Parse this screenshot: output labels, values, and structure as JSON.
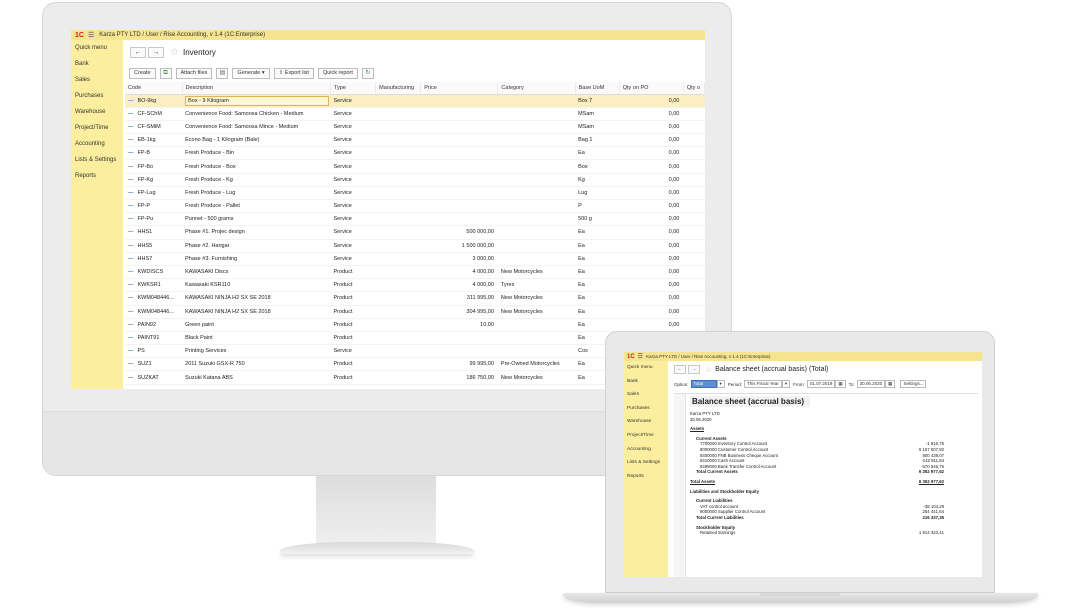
{
  "desktop": {
    "titlebar": "Karza PTY LTD / User / Rise Accounting, v 1.4   (1C:Enterprise)",
    "logo": "1C",
    "sidebar": [
      "Quick menu",
      "Bank",
      "Sales",
      "Purchases",
      "Warehouse",
      "Project/Time",
      "Accounting",
      "Lists & Settings",
      "Reports"
    ],
    "page_title": "Inventory",
    "toolbar": {
      "create": "Create",
      "attach": "Attach files",
      "generate": "Generate",
      "export": "Export list",
      "quick_report": "Quick report"
    },
    "columns": [
      "Code",
      "Description",
      "Type",
      "Manufacturing",
      "Price",
      "Category",
      "Base UoM",
      "Qty on PO",
      "Qty o"
    ],
    "rows": [
      {
        "code": "BO-9kg",
        "desc": "Box - 9 Kilogram",
        "type": "Service",
        "mfg": "",
        "price": "",
        "cat": "",
        "uom": "Box 7",
        "qty": "0,00"
      },
      {
        "code": "CF-SChM",
        "desc": "Convenience Food: Samoosa Chicken - Medium",
        "type": "Service",
        "mfg": "",
        "price": "",
        "cat": "",
        "uom": "MSam",
        "qty": "0,00"
      },
      {
        "code": "CF-SMiM",
        "desc": "Convenience Food: Samoosa Mince - Medium",
        "type": "Service",
        "mfg": "",
        "price": "",
        "cat": "",
        "uom": "MSam",
        "qty": "0,00"
      },
      {
        "code": "EB-1kg",
        "desc": "Econo Bag - 1 Kilogram (Bale)",
        "type": "Service",
        "mfg": "",
        "price": "",
        "cat": "",
        "uom": "Bag 1",
        "qty": "0,00"
      },
      {
        "code": "FP-B",
        "desc": "Fresh Produce - Bin",
        "type": "Service",
        "mfg": "",
        "price": "",
        "cat": "",
        "uom": "Ea",
        "qty": "0,00"
      },
      {
        "code": "FP-Bo",
        "desc": "Fresh Produce - Box",
        "type": "Service",
        "mfg": "",
        "price": "",
        "cat": "",
        "uom": "Box",
        "qty": "0,00"
      },
      {
        "code": "FP-Kg",
        "desc": "Fresh Produce - Kg",
        "type": "Service",
        "mfg": "",
        "price": "",
        "cat": "",
        "uom": "Kg",
        "qty": "0,00"
      },
      {
        "code": "FP-Lug",
        "desc": "Fresh Produce - Lug",
        "type": "Service",
        "mfg": "",
        "price": "",
        "cat": "",
        "uom": "Lug",
        "qty": "0,00"
      },
      {
        "code": "FP-P",
        "desc": "Fresh Produce - Pallet",
        "type": "Service",
        "mfg": "",
        "price": "",
        "cat": "",
        "uom": "P",
        "qty": "0,00"
      },
      {
        "code": "FP-Pu",
        "desc": "Punnet - 500 grams",
        "type": "Service",
        "mfg": "",
        "price": "",
        "cat": "",
        "uom": "500 g",
        "qty": "0,00"
      },
      {
        "code": "HHS1",
        "desc": "Phase #1. Projec design",
        "type": "Service",
        "mfg": "",
        "price": "500 000,00",
        "cat": "",
        "uom": "Ea",
        "qty": "0,00"
      },
      {
        "code": "HHS5",
        "desc": "Phase #2. Hangar",
        "type": "Service",
        "mfg": "",
        "price": "1 500 000,00",
        "cat": "",
        "uom": "Ea",
        "qty": "0,00"
      },
      {
        "code": "HHS7",
        "desc": "Phase #3. Furnishing",
        "type": "Service",
        "mfg": "",
        "price": "3 000,00",
        "cat": "",
        "uom": "Ea",
        "qty": "0,00"
      },
      {
        "code": "KWDISCS",
        "desc": "KAWASAKI Discs",
        "type": "Product",
        "mfg": "",
        "price": "4 000,00",
        "cat": "New Motorcycles",
        "uom": "Ea",
        "qty": "0,00"
      },
      {
        "code": "KWKSR1",
        "desc": "Kawasaki KSR110",
        "type": "Product",
        "mfg": "",
        "price": "4 000,00",
        "cat": "Tyres",
        "uom": "Ea",
        "qty": "0,00"
      },
      {
        "code": "KWM048446...",
        "desc": "KAWASAKI NINJA H2 SX SE 2018",
        "type": "Product",
        "mfg": "",
        "price": "311 995,00",
        "cat": "New Motorcycles",
        "uom": "Ea",
        "qty": "0,00"
      },
      {
        "code": "KWM048446...",
        "desc": "KAWASAKI NINJA H2 SX SE 2018",
        "type": "Product",
        "mfg": "",
        "price": "304 995,00",
        "cat": "New Motorcycles",
        "uom": "Ea",
        "qty": "0,00"
      },
      {
        "code": "PAIN92",
        "desc": "Green paint",
        "type": "Product",
        "mfg": "",
        "price": "10,00",
        "cat": "",
        "uom": "Ea",
        "qty": "0,00"
      },
      {
        "code": "PAINT91",
        "desc": "Black Paint",
        "type": "Product",
        "mfg": "",
        "price": "",
        "cat": "",
        "uom": "Ea",
        "qty": ""
      },
      {
        "code": "PS",
        "desc": "Printing Services",
        "type": "Service",
        "mfg": "",
        "price": "",
        "cat": "",
        "uom": "Cos",
        "qty": ""
      },
      {
        "code": "SUZ1",
        "desc": "2011 Suzuki GSX-R 750",
        "type": "Product",
        "mfg": "",
        "price": "99 995,00",
        "cat": "Pre-Owned Motorcycles",
        "uom": "Ea",
        "qty": ""
      },
      {
        "code": "SUZKAT",
        "desc": "Suzuki Katana ABS",
        "type": "Product",
        "mfg": "",
        "price": "186 750,00",
        "cat": "New Motorcycles",
        "uom": "Ea",
        "qty": ""
      }
    ]
  },
  "laptop": {
    "titlebar": "Karza PTY LTD / User / Rise Accounting, v 1.4   (1C:Enterprise)",
    "logo": "1C",
    "sidebar": [
      "Quick menu",
      "Bank",
      "Sales",
      "Purchases",
      "Warehouse",
      "Project/Time",
      "Accounting",
      "Lists & Settings",
      "Reports"
    ],
    "page_title": "Balance sheet (accrual basis) (Total)",
    "options": {
      "option_label": "Option:",
      "option_value": "Total",
      "period_label": "Period:",
      "period_value": "This Fiscal Year",
      "from_label": "From:",
      "from_value": "01.07.2019",
      "to_label": "To:",
      "to_value": "30.06.2020",
      "settings": "Settings..."
    },
    "report": {
      "title": "Balance sheet (accrual basis)",
      "company": "Karza PTY LTD",
      "date": "30.06.2020",
      "assets_heading": "Assets",
      "current_assets_heading": "Current Assets",
      "current_assets": [
        {
          "label": "7700000 Inventory Control Account",
          "value": "-1 916,75"
        },
        {
          "label": "8000000 Customer Control Account",
          "value": "6 167 007,92"
        },
        {
          "label": "8400000 FNB Business Cheque Account",
          "value": "900 439,07"
        },
        {
          "label": "8410000 Cash Account",
          "value": "-142 911,84"
        },
        {
          "label": "8499000 Bank Transfer Control Account",
          "value": "-570 546,75"
        }
      ],
      "total_current_assets": {
        "label": "Total Current Assets",
        "value": "6 352 977,62"
      },
      "total_assets": {
        "label": "Total Assets",
        "value": "6 352 977,62"
      },
      "liab_heading": "Liabilities and Stockholder Equity",
      "current_liab_heading": "Current Liabilities",
      "current_liabilities": [
        {
          "label": "VAT control account",
          "value": "-38 104,29"
        },
        {
          "label": "9000000 Supplier Control Account",
          "value": "254 441,64"
        }
      ],
      "total_current_liabilities": {
        "label": "Total Current Liabilities",
        "value": "216 337,35"
      },
      "equity_heading": "Stockholder Equity",
      "retained": {
        "label": "Retained Earnings",
        "value": "1 914 323,41"
      }
    }
  },
  "colors": {
    "titlebar": "#f7e48f",
    "sidebar": "#fbee9f",
    "selected_row": "#fbeec1",
    "logo": "#d01e1e"
  }
}
